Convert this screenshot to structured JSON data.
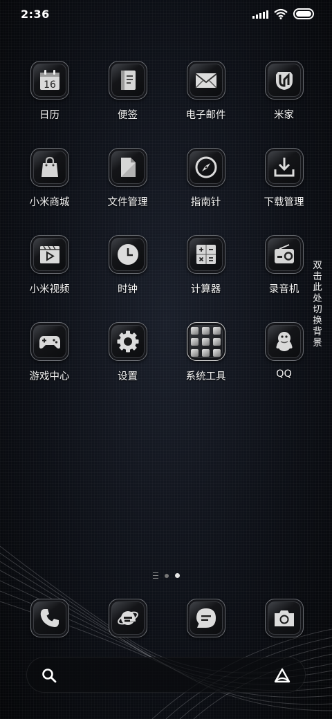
{
  "status_bar": {
    "time": "2:36",
    "signal_icon": "signal-bars-icon",
    "wifi_icon": "wifi-icon",
    "battery_icon": "battery-icon",
    "battery_level": 1.0
  },
  "apps": [
    {
      "label": "日历",
      "icon": "calendar-icon",
      "icon_text": "16"
    },
    {
      "label": "便签",
      "icon": "notes-icon"
    },
    {
      "label": "电子邮件",
      "icon": "mail-icon"
    },
    {
      "label": "米家",
      "icon": "mijia-icon"
    },
    {
      "label": "小米商城",
      "icon": "shopping-bag-icon"
    },
    {
      "label": "文件管理",
      "icon": "file-icon"
    },
    {
      "label": "指南针",
      "icon": "compass-icon"
    },
    {
      "label": "下载管理",
      "icon": "download-icon"
    },
    {
      "label": "小米视频",
      "icon": "video-icon"
    },
    {
      "label": "时钟",
      "icon": "clock-icon"
    },
    {
      "label": "计算器",
      "icon": "calculator-icon"
    },
    {
      "label": "录音机",
      "icon": "recorder-icon"
    },
    {
      "label": "游戏中心",
      "icon": "gamepad-icon"
    },
    {
      "label": "设置",
      "icon": "gear-icon"
    },
    {
      "label": "系统工具",
      "icon": "folder-grid-icon"
    },
    {
      "label": "QQ",
      "icon": "qq-penguin-icon"
    }
  ],
  "side_hint": "双击此处切换背景",
  "page_indicator": {
    "pages": 2,
    "current": 2
  },
  "dock": [
    {
      "name": "phone",
      "icon": "phone-icon"
    },
    {
      "name": "browser",
      "icon": "browser-e-icon"
    },
    {
      "name": "messages",
      "icon": "message-bubble-icon"
    },
    {
      "name": "camera",
      "icon": "camera-icon"
    }
  ],
  "search_bar": {
    "search_icon": "search-icon",
    "assistant_icon": "assistant-icon"
  }
}
